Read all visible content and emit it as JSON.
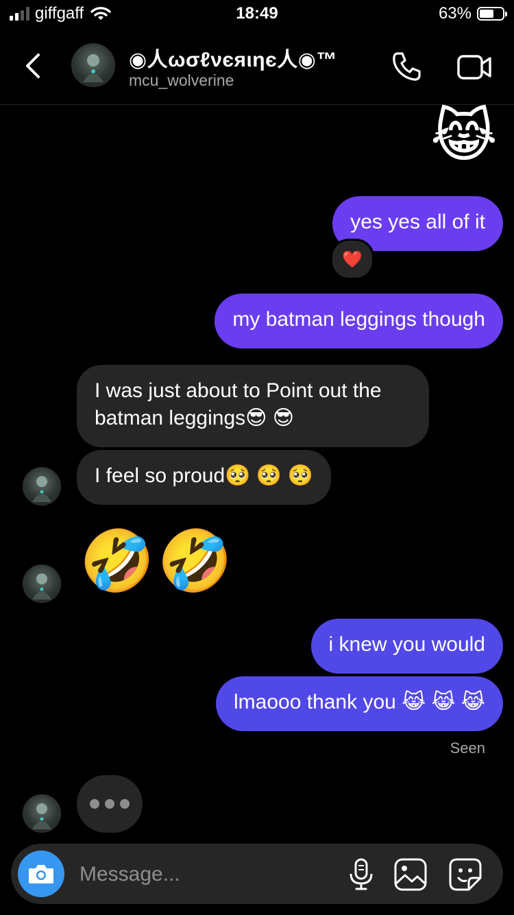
{
  "status_bar": {
    "carrier": "giffgaff",
    "time": "18:49",
    "battery": "63%",
    "battery_level": 0.63
  },
  "header": {
    "display_name": "◉人ωσℓνєяιηє人◉™",
    "username": "mcu_wolverine"
  },
  "messages": {
    "cat_emoji": "😹",
    "msg1": "yes yes all of it",
    "msg1_reaction": "❤️",
    "msg2": "my batman leggings though",
    "msg3_line1": "I was just about to Point out the",
    "msg3_line2": "batman leggings😎 😎",
    "msg4": "I feel so proud🥺 🥺 🥺",
    "msg5_emoji": "🤣🤣",
    "msg6": "i knew you would",
    "msg7": "lmaooo thank you 😹 😹 😹",
    "seen": "Seen"
  },
  "composer": {
    "placeholder": "Message..."
  },
  "colors": {
    "outgoing_purple": "#6a3ef0",
    "outgoing_blue": "#5148e8",
    "incoming": "#262626",
    "camera_blue": "#3797f0"
  },
  "icons": [
    "back-arrow-icon",
    "phone-icon",
    "video-camera-icon",
    "camera-icon",
    "microphone-icon",
    "gallery-icon",
    "sticker-icon"
  ]
}
